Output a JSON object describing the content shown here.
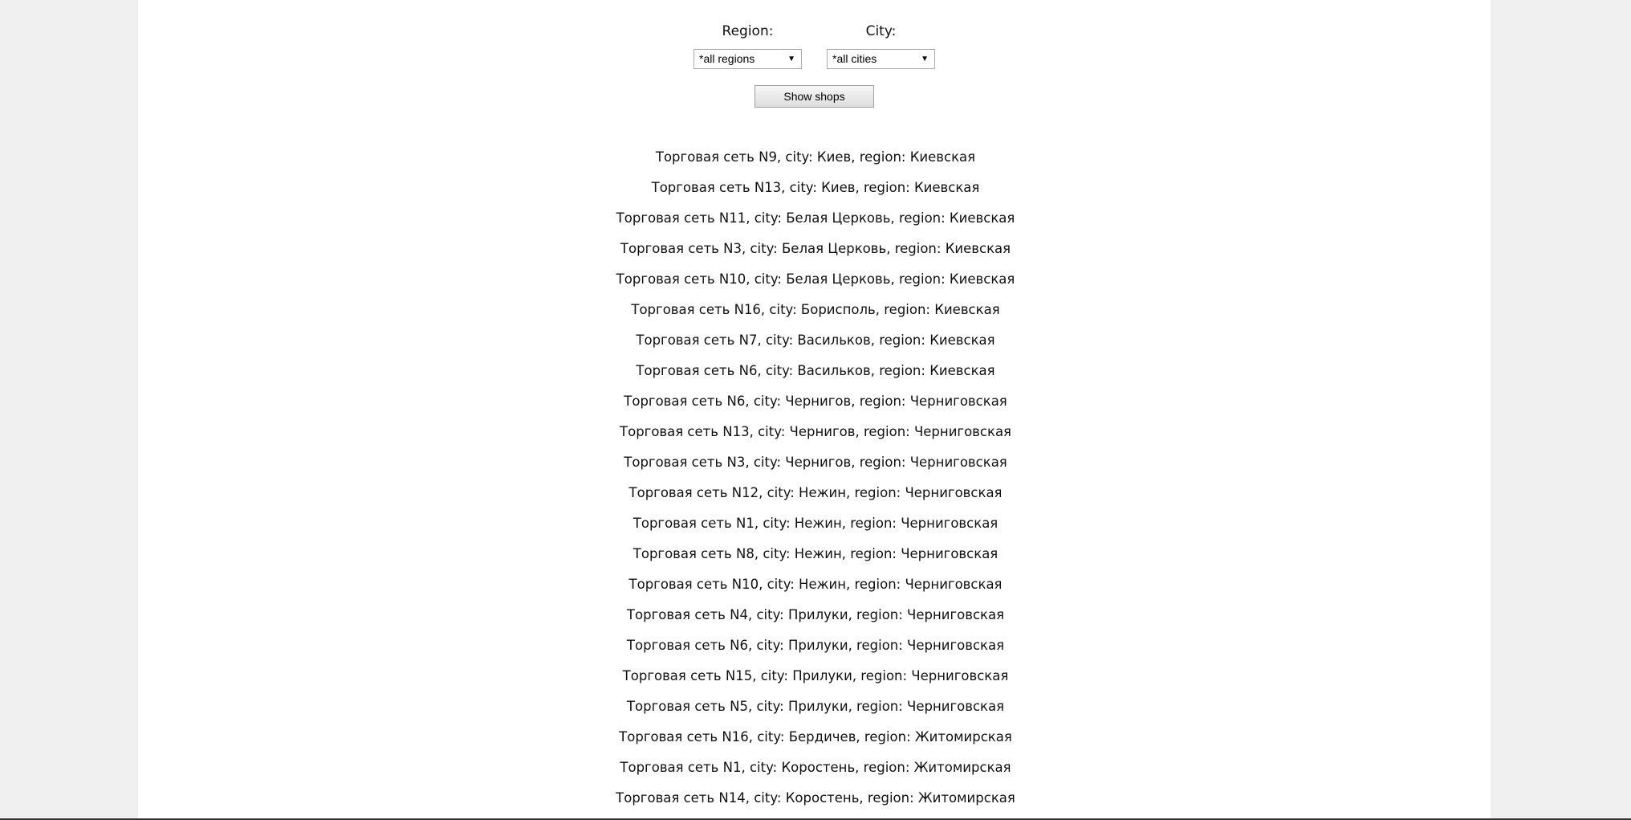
{
  "filters": {
    "region_label": "Region:",
    "city_label": "City:",
    "region_value": "*all regions",
    "city_value": "*all cities",
    "show_button": "Show shops"
  },
  "shops": [
    "Торговая сеть N9, city: Киев, region: Киевская",
    "Торговая сеть N13, city: Киев, region: Киевская",
    "Торговая сеть N11, city: Белая Церковь, region: Киевская",
    "Торговая сеть N3, city: Белая Церковь, region: Киевская",
    "Торговая сеть N10, city: Белая Церковь, region: Киевская",
    "Торговая сеть N16, city: Борисполь, region: Киевская",
    "Торговая сеть N7, city: Васильков, region: Киевская",
    "Торговая сеть N6, city: Васильков, region: Киевская",
    "Торговая сеть N6, city: Чернигов, region: Черниговская",
    "Торговая сеть N13, city: Чернигов, region: Черниговская",
    "Торговая сеть N3, city: Чернигов, region: Черниговская",
    "Торговая сеть N12, city: Нежин, region: Черниговская",
    "Торговая сеть N1, city: Нежин, region: Черниговская",
    "Торговая сеть N8, city: Нежин, region: Черниговская",
    "Торговая сеть N10, city: Нежин, region: Черниговская",
    "Торговая сеть N4, city: Прилуки, region: Черниговская",
    "Торговая сеть N6, city: Прилуки, region: Черниговская",
    "Торговая сеть N15, city: Прилуки, region: Черниговская",
    "Торговая сеть N5, city: Прилуки, region: Черниговская",
    "Торговая сеть N16, city: Бердичев, region: Житомирская",
    "Торговая сеть N1, city: Коростень, region: Житомирская",
    "Торговая сеть N14, city: Коростень, region: Житомирская"
  ]
}
